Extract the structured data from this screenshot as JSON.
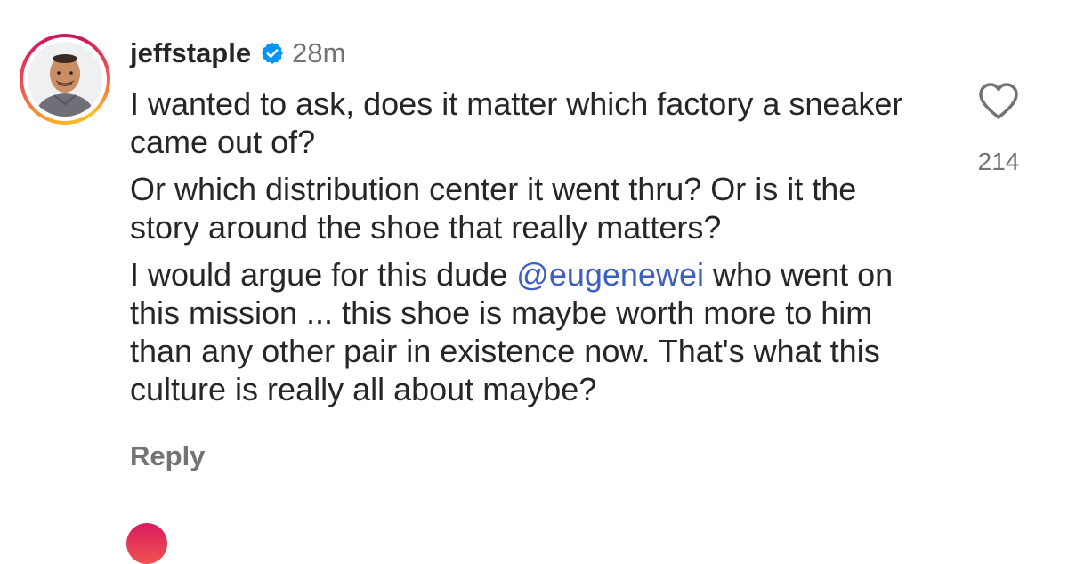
{
  "comment": {
    "username": "jeffstaple",
    "verified": true,
    "time": "28m",
    "paragraphs": [
      "I wanted to ask, does it matter which factory a sneaker came out of?",
      "Or which distribution center it went thru? Or is it the story around the shoe that really matters?"
    ],
    "p3_before": "I would argue for this dude ",
    "mention": "@eugenewei",
    "p3_after": " who went on this mission ... this shoe is maybe worth more to him than any other pair in existence now. That's what this culture is really all about maybe?",
    "like_count": "214",
    "reply_label": "Reply"
  },
  "colors": {
    "mention": "#3c5fc0",
    "secondary_text": "#737373",
    "verified_badge": "#0095f6"
  },
  "icons": {
    "like": "heart-outline-icon",
    "verified": "verified-badge-icon"
  }
}
